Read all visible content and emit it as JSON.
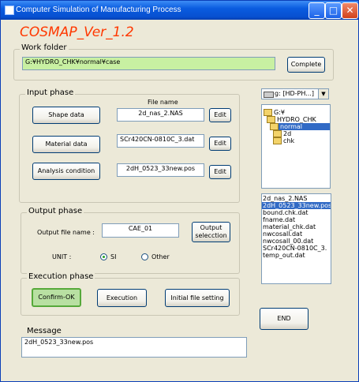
{
  "window": {
    "title": "Computer Simulation of Manufacturing Process",
    "minimize": "_",
    "maximize": "□",
    "close": "✕"
  },
  "app_title": "COSMAP_Ver_1.2",
  "work_folder": {
    "label": "Work folder",
    "path": "G:¥HYDRO_CHK¥normal¥case",
    "complete_button": "Complete"
  },
  "input_phase": {
    "label": "Input phase",
    "file_name_header": "File name",
    "rows": [
      {
        "button": "Shape data",
        "file": "2d_nas_2.NAS",
        "edit": "Edit"
      },
      {
        "button": "Material data",
        "file": "SCr420CN-0810C_3.dat",
        "edit": "Edit"
      },
      {
        "button": "Analysis condition",
        "file": "2dH_0523_33new.pos",
        "edit": "Edit"
      }
    ]
  },
  "drive": {
    "value": "g: [HD-PH...]"
  },
  "directories": [
    "G:¥",
    "HYDRO_CHK",
    "normal",
    "2d",
    "chk"
  ],
  "files": [
    "2d_nas_2.NAS",
    "2dH_0523_33new.pos",
    "bound.chk.dat",
    "fname.dat",
    "material_chk.dat",
    "nwcosall.dat",
    "nwcosall_00.dat",
    "SCr420CN-0810C_3.",
    "temp_out.dat"
  ],
  "output_phase": {
    "label": "Output phase",
    "file_label": "Output file name :",
    "file_value": "CAE_01",
    "selection_button": "Output selecction",
    "unit_label": "UNIT :",
    "unit_si": "SI",
    "unit_other": "Other",
    "unit_selected": "SI"
  },
  "execution_phase": {
    "label": "Execution phase",
    "confirm": "Confirm-OK",
    "execution": "Execution",
    "initial": "Initial file setting"
  },
  "end_button": "END",
  "message": {
    "label": "Message",
    "text": "2dH_0523_33new.pos"
  }
}
